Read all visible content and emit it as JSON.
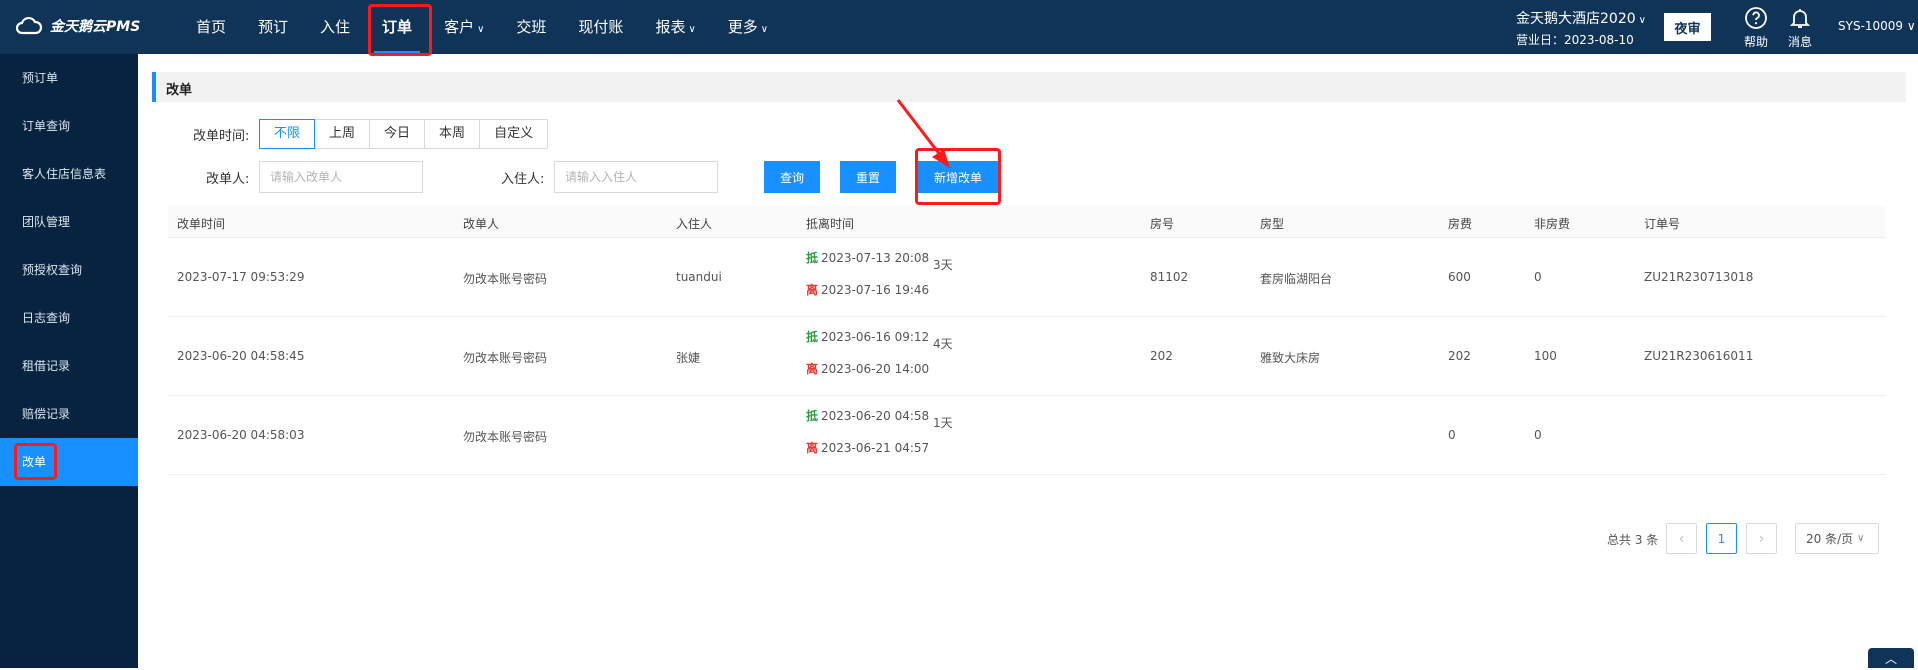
{
  "header": {
    "logo_text": "金天鹅云PMS",
    "nav": [
      {
        "label": "首页",
        "caret": ""
      },
      {
        "label": "预订",
        "caret": ""
      },
      {
        "label": "入住",
        "caret": ""
      },
      {
        "label": "订单",
        "caret": ""
      },
      {
        "label": "客户",
        "caret": "∨"
      },
      {
        "label": "交班",
        "caret": ""
      },
      {
        "label": "现付账",
        "caret": ""
      },
      {
        "label": "报表",
        "caret": "∨"
      },
      {
        "label": "更多",
        "caret": "∨"
      }
    ],
    "active_nav": "订单",
    "hotel_name": "金天鹅大酒店2020",
    "hotel_caret": "∨",
    "business_date": "营业日：2023-08-10",
    "night_audit_label": "夜审",
    "help_label": "帮助",
    "messages_label": "消息",
    "user": "SYS-10009 ∨"
  },
  "sidebar": {
    "items": [
      {
        "label": "预订单"
      },
      {
        "label": "订单查询"
      },
      {
        "label": "客人住店信息表"
      },
      {
        "label": "团队管理"
      },
      {
        "label": "预授权查询"
      },
      {
        "label": "日志查询"
      },
      {
        "label": "租借记录"
      },
      {
        "label": "赔偿记录"
      },
      {
        "label": "改单"
      }
    ],
    "active": "改单"
  },
  "page": {
    "title": "改单",
    "filters": {
      "time_label": "改单时间:",
      "time_options": [
        "不限",
        "上周",
        "今日",
        "本周",
        "自定义"
      ],
      "time_selected": "不限",
      "modifier_label": "改单人:",
      "modifier_placeholder": "请输入改单人",
      "guest_label": "入住人:",
      "guest_placeholder": "请输入入住人",
      "query_button": "查询",
      "reset_button": "重置",
      "add_button": "新增改单"
    },
    "table": {
      "columns": [
        "改单时间",
        "改单人",
        "入住人",
        "抵离时间",
        "房号",
        "房型",
        "房费",
        "非房费",
        "订单号"
      ],
      "arrive_tag": "抵",
      "depart_tag": "离",
      "rows": [
        {
          "time": "2023-07-17 09:53:29",
          "modifier": "勿改本账号密码",
          "guest": "tuandui",
          "arrive": "2023-07-13 20:08",
          "depart": "2023-07-16 19:46",
          "nights": "3天",
          "room": "81102",
          "room_type": "套房临湖阳台",
          "room_fee": "600",
          "other_fee": "0",
          "order_no": "ZU21R230713018"
        },
        {
          "time": "2023-06-20 04:58:45",
          "modifier": "勿改本账号密码",
          "guest": "张婕",
          "arrive": "2023-06-16 09:12",
          "depart": "2023-06-20 14:00",
          "nights": "4天",
          "room": "202",
          "room_type": "雅致大床房",
          "room_fee": "202",
          "other_fee": "100",
          "order_no": "ZU21R230616011"
        },
        {
          "time": "2023-06-20 04:58:03",
          "modifier": "勿改本账号密码",
          "guest": "",
          "arrive": "2023-06-20 04:58",
          "depart": "2023-06-21 04:57",
          "nights": "1天",
          "room": "",
          "room_type": "",
          "room_fee": "0",
          "other_fee": "0",
          "order_no": ""
        }
      ]
    },
    "pagination": {
      "total_text": "总共 3 条",
      "current_page": "1",
      "page_size": "20 条/页",
      "page_size_caret": "∨"
    },
    "back_to_top_icon": "chevron-up-icon"
  },
  "colors": {
    "topbar": "#0f3458",
    "sidebar": "#08233f",
    "accent": "#1890ff",
    "annotation_red": "#ff1a1a"
  }
}
